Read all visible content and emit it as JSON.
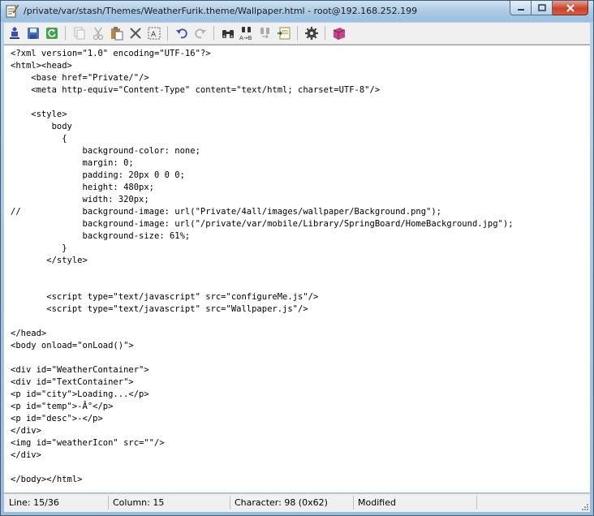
{
  "window": {
    "title": "/private/var/stash/Themes/WeatherFurik.theme/Wallpaper.html - root@192.168.252.199"
  },
  "toolbar": {
    "icons": [
      "new-file-icon",
      "save-icon",
      "reload-icon",
      "copy-icon",
      "cut-icon",
      "paste-icon",
      "delete-icon",
      "select-all-icon",
      "undo-icon",
      "redo-icon",
      "find-icon",
      "replace-icon",
      "find-next-icon",
      "go-to-icon",
      "settings-icon",
      "help-icon"
    ]
  },
  "editor": {
    "lines": [
      "<?xml version=\"1.0\" encoding=\"UTF-16\"?>",
      "<html><head>",
      "    <base href=\"Private/\"/>",
      "    <meta http-equiv=\"Content-Type\" content=\"text/html; charset=UTF-8\"/>",
      "",
      "    <style>",
      "        body",
      "          {",
      "              background-color: none;",
      "              margin: 0;",
      "              padding: 20px 0 0 0;",
      "              height: 480px;",
      "              width: 320px;",
      "//            background-image: url(\"Private/4all/images/wallpaper/Background.png\");",
      "              background-image: url(\"/private/var/mobile/Library/SpringBoard/HomeBackground.jpg\");",
      "              background-size: 61%;",
      "          }",
      "       </style>",
      "",
      "",
      "       <script type=\"text/javascript\" src=\"configureMe.js\"/>",
      "       <script type=\"text/javascript\" src=\"Wallpaper.js\"/>",
      "",
      "</head>",
      "<body onload=\"onLoad()\">",
      "",
      "<div id=\"WeatherContainer\">",
      "<div id=\"TextContainer\">",
      "<p id=\"city\">Loading...</p>",
      "<p id=\"temp\">-Â°</p>",
      "<p id=\"desc\">-</p>",
      "</div>",
      "<img id=\"weatherIcon\" src=\"\"/>",
      "</div>",
      "",
      "</body></html>"
    ]
  },
  "status": {
    "line": "Line: 15/36",
    "column": "Column: 15",
    "character": "Character: 98 (0x62)",
    "state": "Modified"
  },
  "colors": {
    "titlebar": "#a9c8e4",
    "close_button": "#c9452e",
    "editor_background": "#ffffff",
    "toolbar_background": "#f0f0f0"
  }
}
